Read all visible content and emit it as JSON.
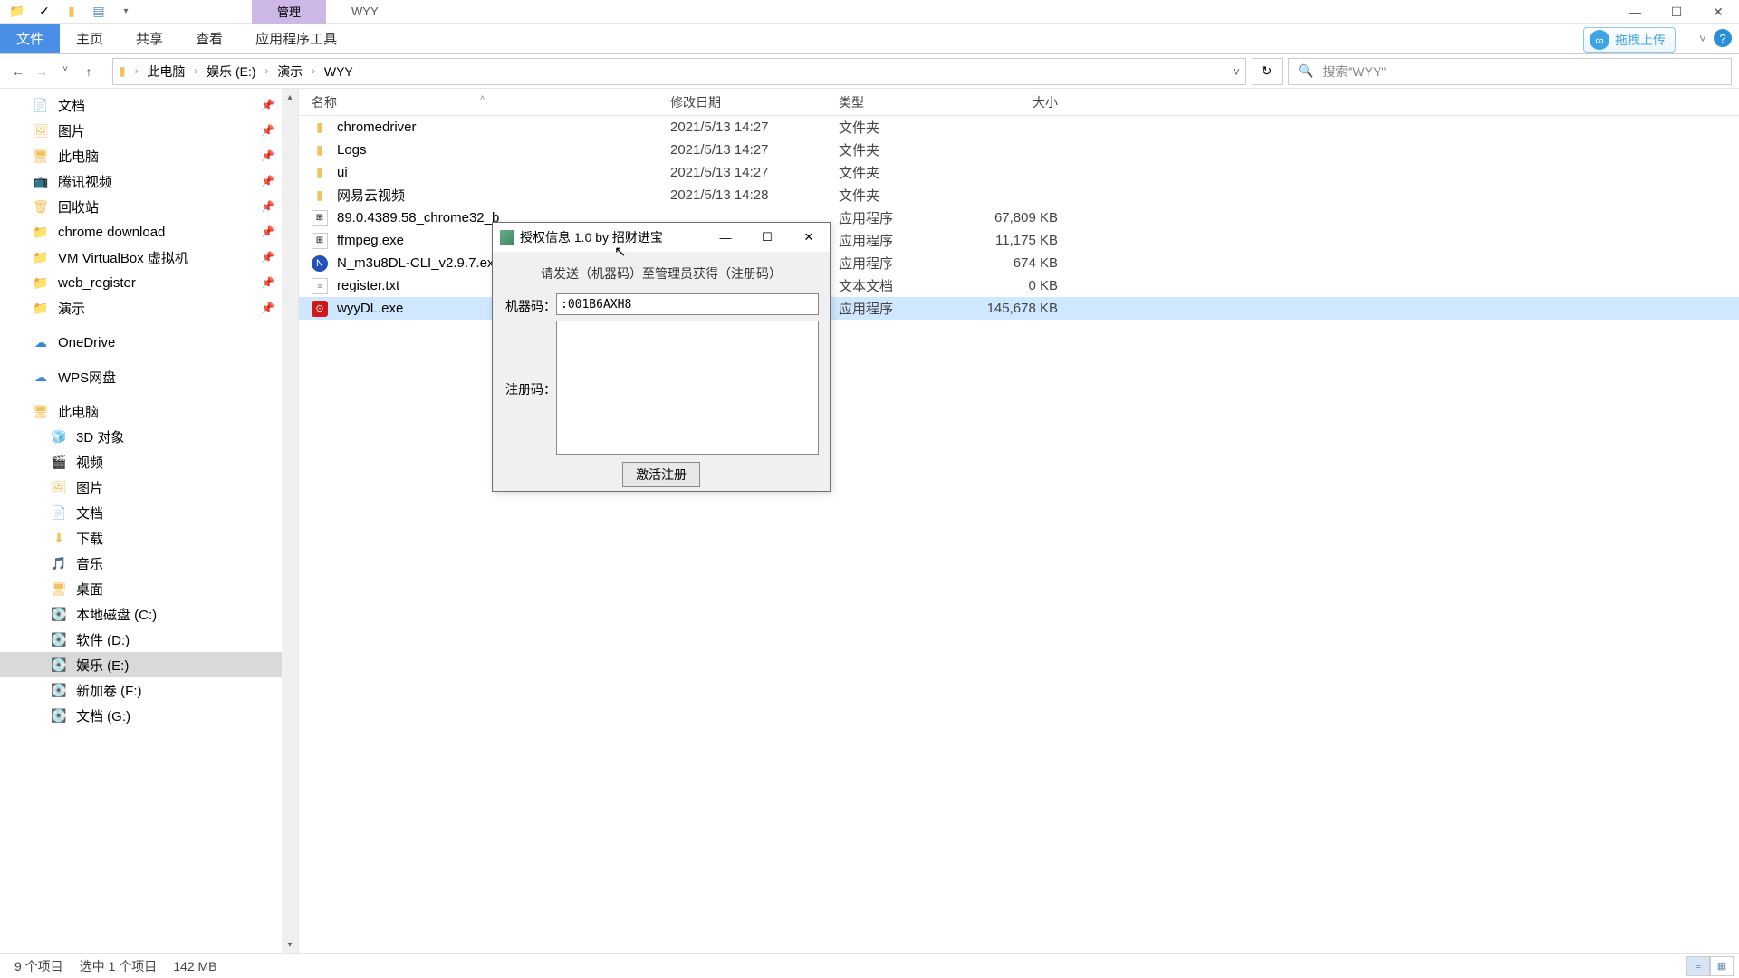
{
  "window": {
    "tab_manage": "管理",
    "tab_wyy": "WYY"
  },
  "ribbon": {
    "file": "文件",
    "home": "主页",
    "share": "共享",
    "view": "查看",
    "apptools": "应用程序工具",
    "upload": "拖拽上传"
  },
  "breadcrumb": {
    "pc": "此电脑",
    "drive": "娱乐 (E:)",
    "folder1": "演示",
    "folder2": "WYY"
  },
  "search": {
    "placeholder": "搜索\"WYY\""
  },
  "columns": {
    "name": "名称",
    "date": "修改日期",
    "type": "类型",
    "size": "大小"
  },
  "sidebar": {
    "items": [
      {
        "label": "文档"
      },
      {
        "label": "图片"
      },
      {
        "label": "此电脑"
      },
      {
        "label": "腾讯视频"
      },
      {
        "label": "回收站"
      },
      {
        "label": "chrome download"
      },
      {
        "label": "VM VirtualBox 虚拟机"
      },
      {
        "label": "web_register"
      },
      {
        "label": "演示"
      },
      {
        "label": "OneDrive"
      },
      {
        "label": "WPS网盘"
      },
      {
        "label": "此电脑"
      },
      {
        "label": "3D 对象"
      },
      {
        "label": "视频"
      },
      {
        "label": "图片"
      },
      {
        "label": "文档"
      },
      {
        "label": "下载"
      },
      {
        "label": "音乐"
      },
      {
        "label": "桌面"
      },
      {
        "label": "本地磁盘 (C:)"
      },
      {
        "label": "软件 (D:)"
      },
      {
        "label": "娱乐 (E:)"
      },
      {
        "label": "新加卷 (F:)"
      },
      {
        "label": "文档 (G:)"
      }
    ]
  },
  "files": [
    {
      "name": "chromedriver",
      "date": "2021/5/13 14:27",
      "type": "文件夹",
      "size": "",
      "kind": "folder"
    },
    {
      "name": "Logs",
      "date": "2021/5/13 14:27",
      "type": "文件夹",
      "size": "",
      "kind": "folder"
    },
    {
      "name": "ui",
      "date": "2021/5/13 14:27",
      "type": "文件夹",
      "size": "",
      "kind": "folder"
    },
    {
      "name": "网易云视频",
      "date": "2021/5/13 14:28",
      "type": "文件夹",
      "size": "",
      "kind": "folder"
    },
    {
      "name": "89.0.4389.58_chrome32_b",
      "date": "",
      "type": "应用程序",
      "size": "67,809 KB",
      "kind": "exe"
    },
    {
      "name": "ffmpeg.exe",
      "date": "",
      "type": "应用程序",
      "size": "11,175 KB",
      "kind": "exe"
    },
    {
      "name": "N_m3u8DL-CLI_v2.9.7.exe",
      "date": "",
      "type": "应用程序",
      "size": "674 KB",
      "kind": "n"
    },
    {
      "name": "register.txt",
      "date": "",
      "type": "文本文档",
      "size": "0 KB",
      "kind": "txt"
    },
    {
      "name": "wyyDL.exe",
      "date": "",
      "type": "应用程序",
      "size": "145,678 KB",
      "kind": "wyy"
    }
  ],
  "statusbar": {
    "items": "9 个项目",
    "selected": "选中 1 个项目",
    "size": "142 MB"
  },
  "dialog": {
    "title": "授权信息 1.0 by 招财进宝",
    "message": "请发送（机器码）至管理员获得（注册码）",
    "machine_label": "机器码：",
    "machine_value": ":001B6AXH8",
    "reg_label": "注册码：",
    "button": "激活注册"
  }
}
